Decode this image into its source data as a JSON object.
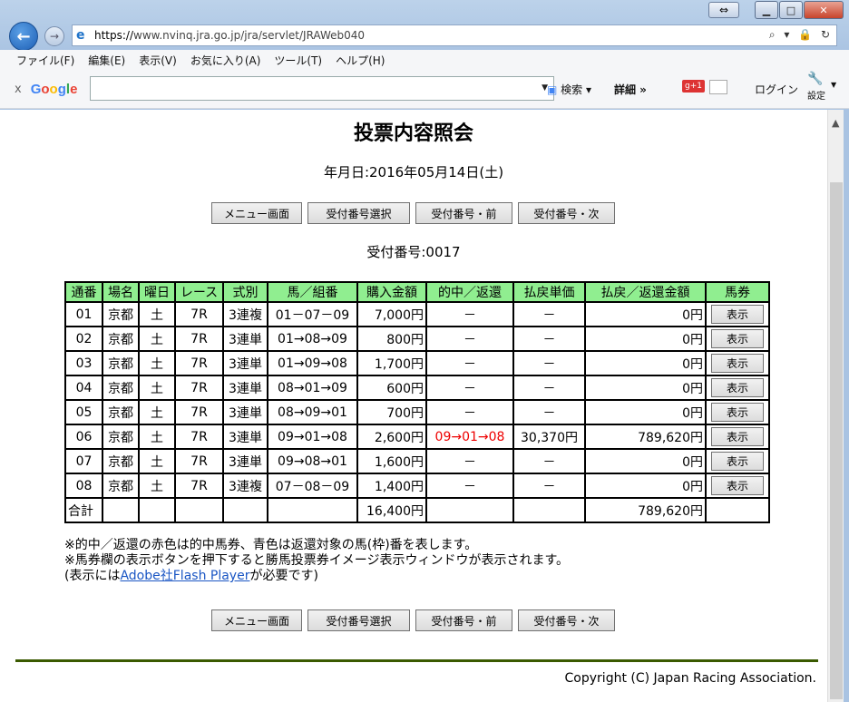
{
  "browser": {
    "url_prefix": "https://",
    "url_rest": "www.nvinq.jra.go.jp/jra/servlet/JRAWeb040",
    "addr_icons": "⌕ ▾ 🔒 ↻",
    "menu": [
      "ファイル(F)",
      "編集(E)",
      "表示(V)",
      "お気に入り(A)",
      "ツール(T)",
      "ヘルプ(H)"
    ],
    "google": {
      "close": "x",
      "logo": "Google",
      "search_label": "検索",
      "detail_label": "詳細 »",
      "login": "ログイン",
      "settings": "設定"
    }
  },
  "page": {
    "title": "投票内容照会",
    "date": "年月日:2016年05月14日(土)",
    "buttons": [
      "メニュー画面",
      "受付番号選択",
      "受付番号・前",
      "受付番号・次"
    ],
    "receipt": "受付番号:0017",
    "table": {
      "headers": [
        "通番",
        "場名",
        "曜日",
        "レース",
        "式別",
        "馬／組番",
        "購入金額",
        "的中／返還",
        "払戻単価",
        "払戻／返還金額",
        "馬券"
      ],
      "rows": [
        [
          "01",
          "京都",
          "土",
          "7R",
          "3連複",
          "01－07－09",
          "7,000円",
          "－",
          "－",
          "0円",
          "表示"
        ],
        [
          "02",
          "京都",
          "土",
          "7R",
          "3連単",
          "01→08→09",
          "800円",
          "－",
          "－",
          "0円",
          "表示"
        ],
        [
          "03",
          "京都",
          "土",
          "7R",
          "3連単",
          "01→09→08",
          "1,700円",
          "－",
          "－",
          "0円",
          "表示"
        ],
        [
          "04",
          "京都",
          "土",
          "7R",
          "3連単",
          "08→01→09",
          "600円",
          "－",
          "－",
          "0円",
          "表示"
        ],
        [
          "05",
          "京都",
          "土",
          "7R",
          "3連単",
          "08→09→01",
          "700円",
          "－",
          "－",
          "0円",
          "表示"
        ],
        [
          "06",
          "京都",
          "土",
          "7R",
          "3連単",
          "09→01→08",
          "2,600円",
          "09→01→08",
          "30,370円",
          "789,620円",
          "表示"
        ],
        [
          "07",
          "京都",
          "土",
          "7R",
          "3連単",
          "09→08→01",
          "1,600円",
          "－",
          "－",
          "0円",
          "表示"
        ],
        [
          "08",
          "京都",
          "土",
          "7R",
          "3連複",
          "07－08－09",
          "1,400円",
          "－",
          "－",
          "0円",
          "表示"
        ]
      ],
      "total_label": "合計",
      "total_amount": "16,400円",
      "total_payout": "789,620円"
    },
    "notes": {
      "line1": "※的中／返還の赤色は的中馬券、青色は返還対象の馬(枠)番を表します。",
      "line2": "※馬券欄の表示ボタンを押下すると勝馬投票券イメージ表示ウィンドウが表示されます。",
      "line3_pre": "(表示には",
      "line3_link": "Adobe社Flash Player",
      "line3_post": "が必要です)"
    },
    "copyright": "Copyright (C) Japan Racing Association."
  },
  "colors": {
    "header_bg": "#90ee90",
    "hit_red": "#e00000",
    "footer_rule": "#3a5a00"
  }
}
